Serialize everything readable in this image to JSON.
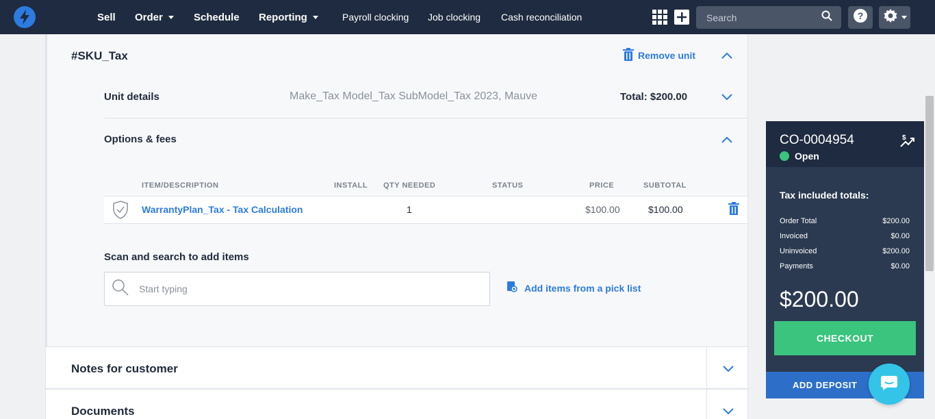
{
  "nav": {
    "items": [
      {
        "label": "Sell"
      },
      {
        "label": "Order"
      },
      {
        "label": "Schedule"
      },
      {
        "label": "Reporting"
      }
    ],
    "links": [
      {
        "label": "Payroll clocking"
      },
      {
        "label": "Job clocking"
      },
      {
        "label": "Cash reconciliation"
      }
    ],
    "search_placeholder": "Search"
  },
  "unit": {
    "sku": "#SKU_Tax",
    "remove_label": "Remove unit",
    "details_label": "Unit details",
    "description": "Make_Tax Model_Tax SubModel_Tax 2023, Mauve",
    "total": "Total: $200.00"
  },
  "options": {
    "label": "Options & fees",
    "headers": {
      "item": "ITEM/DESCRIPTION",
      "install": "INSTALL",
      "qty": "QTY NEEDED",
      "status": "STATUS",
      "price": "PRICE",
      "subtotal": "SUBTOTAL"
    },
    "rows": [
      {
        "item": "WarrantyPlan_Tax - Tax Calculation",
        "qty": "1",
        "price": "$100.00",
        "subtotal": "$100.00"
      }
    ]
  },
  "scan": {
    "label": "Scan and search to add items",
    "placeholder": "Start typing",
    "picklist_label": "Add items from a pick list"
  },
  "sections": {
    "notes": "Notes for customer",
    "documents": "Documents"
  },
  "summary": {
    "order_number": "CO-0004954",
    "status": "Open",
    "totals_heading": "Tax included totals:",
    "lines": [
      {
        "label": "Order Total",
        "value": "$200.00"
      },
      {
        "label": "Invoiced",
        "value": "$0.00"
      },
      {
        "label": "Uninvoiced",
        "value": "$200.00"
      },
      {
        "label": "Payments",
        "value": "$0.00"
      }
    ],
    "grand_total": "$200.00",
    "checkout_label": "CHECKOUT",
    "deposit_label": "ADD DEPOSIT"
  },
  "colors": {
    "nav_bg": "#1f2b40",
    "accent": "#2d7be0",
    "success": "#3ac47d",
    "chat": "#33c4e8"
  }
}
